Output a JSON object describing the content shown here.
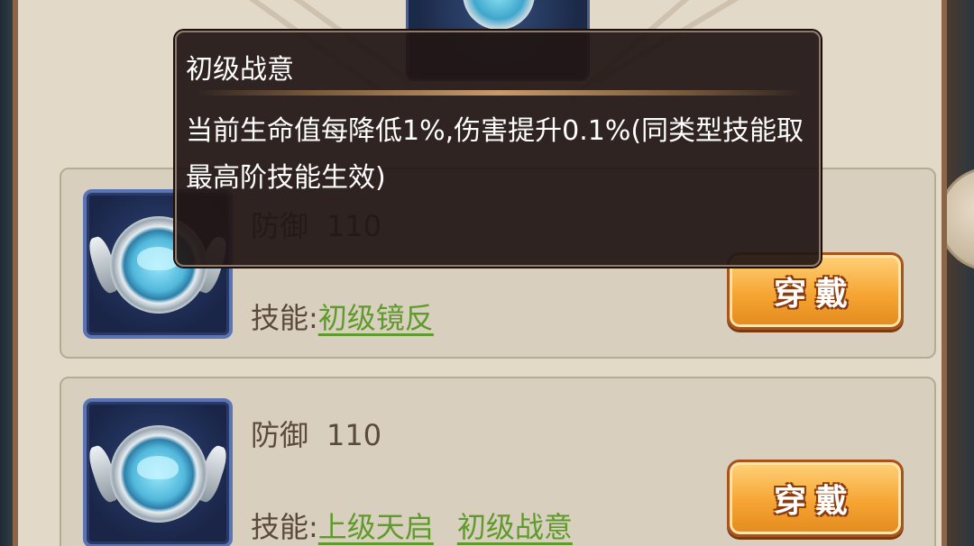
{
  "tooltip": {
    "title": "初级战意",
    "description": "当前生命值每降低1%,伤害提升0.1%(同类型技能取最高阶技能生效)"
  },
  "items": [
    {
      "stat_label": "防御",
      "stat_value": "110",
      "skills_label": "技能:",
      "skills": [
        "初级镜反"
      ],
      "equip_label": "穿戴"
    },
    {
      "stat_label": "防御",
      "stat_value": "110",
      "skills_label": "技能:",
      "skills": [
        "上级天启",
        "初级战意"
      ],
      "equip_label": "穿戴"
    }
  ],
  "colors": {
    "panel": "#e3d9c8",
    "card": "#d8cfbe",
    "skill_link": "#5e9b2a",
    "button": "#f6a533",
    "tooltip_bg": "#211614"
  },
  "icons": [
    "shield-gem-icon"
  ]
}
